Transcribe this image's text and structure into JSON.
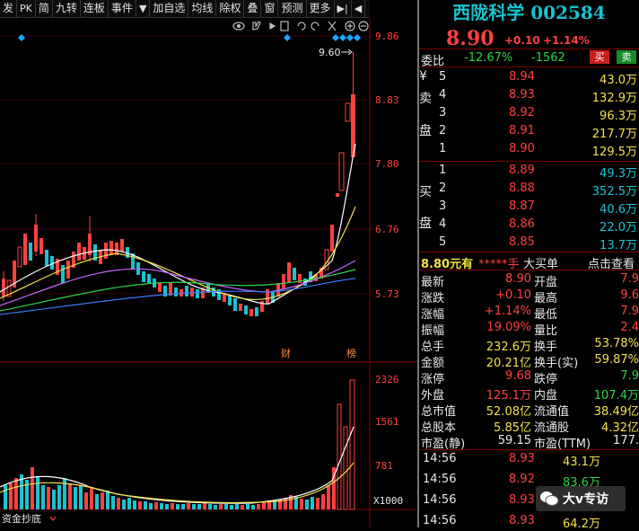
{
  "toolbar": {
    "buttons": [
      "发",
      "PK",
      "简",
      "九转",
      "连板",
      "事件",
      "▼",
      "加自选",
      "均线",
      "除权",
      "叠",
      "窗",
      "预测",
      "更多",
      "▶|",
      "◀"
    ]
  },
  "chart": {
    "price_axis": [
      "9.86",
      "8.83",
      "7.80",
      "6.76",
      "5.73"
    ],
    "high_marker": "9.60",
    "event_tags": [
      "财",
      "榜"
    ],
    "volume_axis": [
      "2326",
      "1561",
      "781",
      "X1000"
    ],
    "footer_label": "资金抄底",
    "colors": {
      "up": "#ff4040",
      "down": "#19c3d0",
      "ma5": "#ffffff",
      "ma10": "#f2e24a",
      "ma20": "#c466ff",
      "ma60": "#2bd44a"
    }
  },
  "quote": {
    "name": "西陇科学",
    "code": "002584",
    "price": "8.90",
    "change": "+0.10",
    "change_pct": "+1.14%",
    "weibi_label": "委比",
    "weibi_pct": "-12.67%",
    "weicha": "-1562",
    "buy_btn": "买",
    "sell_btn": "卖",
    "sell_side_label": [
      "¥",
      "卖",
      "",
      "盘",
      ""
    ],
    "buy_side_label": [
      "",
      "买",
      "",
      "盘",
      ""
    ],
    "asks": [
      {
        "lvl": "5",
        "price": "8.94",
        "vol": "43.0万"
      },
      {
        "lvl": "4",
        "price": "8.93",
        "vol": "132.9万"
      },
      {
        "lvl": "3",
        "price": "8.92",
        "vol": "96.3万"
      },
      {
        "lvl": "2",
        "price": "8.91",
        "vol": "217.7万"
      },
      {
        "lvl": "1",
        "price": "8.90",
        "vol": "129.5万"
      }
    ],
    "bids": [
      {
        "lvl": "1",
        "price": "8.89",
        "vol": "49.3万"
      },
      {
        "lvl": "2",
        "price": "8.88",
        "vol": "352.5万"
      },
      {
        "lvl": "3",
        "price": "8.87",
        "vol": "40.6万"
      },
      {
        "lvl": "4",
        "price": "8.86",
        "vol": "22.0万"
      },
      {
        "lvl": "5",
        "price": "8.85",
        "vol": "13.7万"
      }
    ],
    "bar_text": "8.80元有",
    "bar_star": "*****手",
    "bar_big": "大买单",
    "bar_click": "点击查看",
    "stats": [
      [
        "最新",
        "8.90",
        "开盘",
        "7.9"
      ],
      [
        "涨跌",
        "+0.10",
        "最高",
        "9.6"
      ],
      [
        "涨幅",
        "+1.14%",
        "最低",
        "7.9"
      ],
      [
        "振幅",
        "19.09%",
        "量比",
        "2.4"
      ],
      [
        "总手",
        "232.6万",
        "换手",
        "53.78%"
      ],
      [
        "金额",
        "20.21亿",
        "换手(实)",
        "59.87%"
      ],
      [
        "涨停",
        "9.68",
        "跌停",
        "7.9"
      ],
      [
        "外盘",
        "125.1万",
        "内盘",
        "107.4万"
      ],
      [
        "总市值",
        "52.08亿",
        "流通值",
        "38.49亿"
      ],
      [
        "总股本",
        "5.85亿",
        "流通股",
        "4.32亿"
      ],
      [
        "市盈(静)",
        "59.15",
        "市盈(TTM)",
        "177."
      ]
    ],
    "ticks": [
      {
        "time": "14:56",
        "price": "8.93",
        "vol": "43.1万"
      },
      {
        "time": "14:56",
        "price": "8.92",
        "vol": "83.6万"
      },
      {
        "time": "14:56",
        "price": "8.93",
        "vol": ""
      },
      {
        "time": "14:56",
        "price": "8.93",
        "vol": "64.2万"
      }
    ],
    "watermark": "大v专访"
  }
}
